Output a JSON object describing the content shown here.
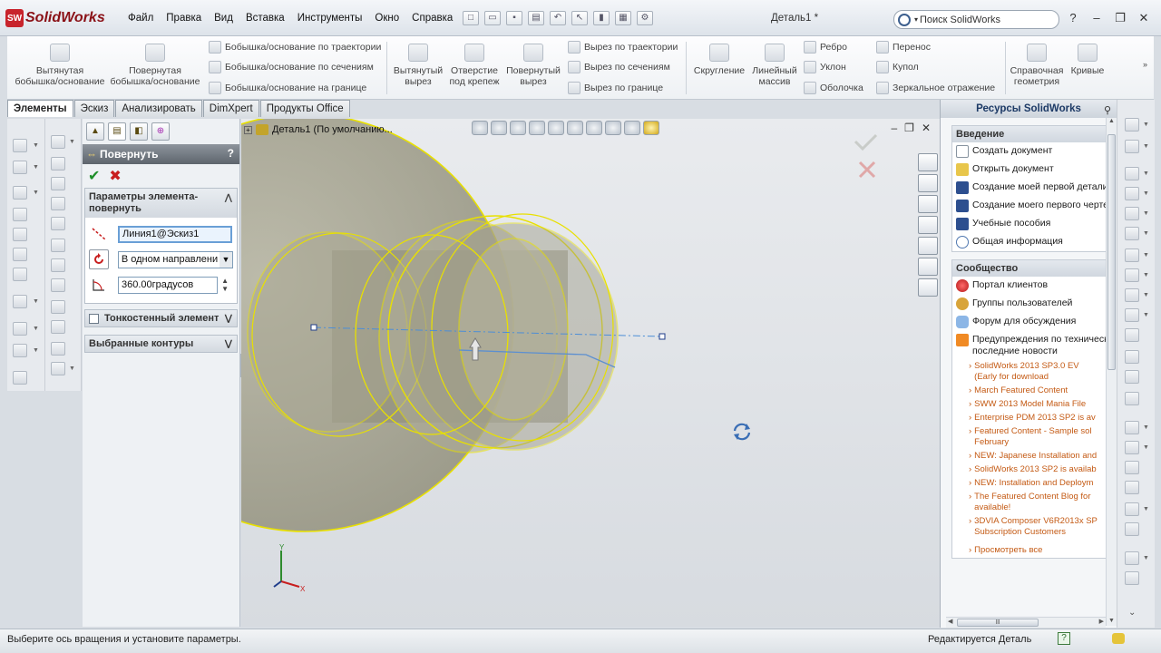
{
  "app": {
    "logo_text": "SolidWorks",
    "logo_mark": "SW",
    "document_title": "Деталь1 *"
  },
  "menu": [
    "Файл",
    "Правка",
    "Вид",
    "Вставка",
    "Инструменты",
    "Окно",
    "Справка"
  ],
  "search": {
    "placeholder": "Поиск SolidWorks"
  },
  "window_controls": {
    "help": "?",
    "minimize": "–",
    "restore": "❐",
    "close": "✕"
  },
  "command_manager": {
    "extruded_boss": "Вытянутая бобышка/основание",
    "revolved_boss": "Повернутая бобышка/основание",
    "swept_boss": "Бобышка/основание по траектории",
    "lofted_boss": "Бобышка/основание по сечениям",
    "boundary_boss": "Бобышка/основание на границе",
    "extruded_cut": "Вытянутый вырез",
    "hole_wizard": "Отверстие под крепеж",
    "revolved_cut": "Повернутый вырез",
    "swept_cut": "Вырез по траектории",
    "lofted_cut": "Вырез по сечениям",
    "boundary_cut": "Вырез по границе",
    "fillet": "Скругление",
    "linear_pattern": "Линейный массив",
    "rib": "Ребро",
    "draft": "Уклон",
    "shell": "Оболочка",
    "wrap": "Перенос",
    "dome": "Купол",
    "mirror": "Зеркальное отражение",
    "reference_geometry": "Справочная геометрия",
    "curves": "Кривые"
  },
  "tabs": [
    "Элементы",
    "Эскиз",
    "Анализировать",
    "DimXpert",
    "Продукты Office"
  ],
  "property_manager": {
    "title": "Повернуть",
    "help": "?",
    "ok": "✔",
    "cancel": "✖",
    "params_title": "Параметры элемента-повернуть",
    "axis_value": "Линия1@Эскиз1",
    "direction_value": "В одном направлени",
    "angle_value": "360.00градусов",
    "thin_feature": "Тонкостенный элемент",
    "selected_contours": "Выбранные контуры"
  },
  "viewport": {
    "tree_label": "Деталь1  (По умолчанию...",
    "triad_y": "Y",
    "triad_x": "X"
  },
  "task_pane": {
    "title": "Ресурсы SolidWorks",
    "intro_title": "Введение",
    "intro_items": [
      "Создать документ",
      "Открыть документ",
      "Создание моей первой детали",
      "Создание моего первого чертежа",
      "Учебные пособия",
      "Общая информация"
    ],
    "community_title": "Сообщество",
    "community_items": [
      "Портал клиентов",
      "Группы пользователей",
      "Форум для обсуждения",
      "Предупреждения по технической",
      "последние новости"
    ],
    "news": [
      "SolidWorks 2013 SP3.0 EV (Early for download",
      "March Featured Content",
      "SWW 2013 Model Mania File",
      "Enterprise PDM 2013 SP2 is av",
      "Featured Content - Sample sol February",
      "NEW: Japanese Installation and",
      "SolidWorks 2013 SP2 is availab",
      "NEW: Installation and Deploym",
      "The Featured Content Blog for available!",
      "3DVIA Composer V6R2013x SP Subscription Customers",
      "Просмотреть все"
    ],
    "scroll_handle": "Ⅲ"
  },
  "status_bar": {
    "message": "Выберите ось вращения и установите параметры.",
    "mode": "Редактируется Деталь",
    "help": "?"
  },
  "colors": {
    "accent_red": "#c8242c",
    "sketch_yellow": "#e8e000",
    "model_gray": "#a5a38f",
    "link_orange": "#c45a14"
  }
}
